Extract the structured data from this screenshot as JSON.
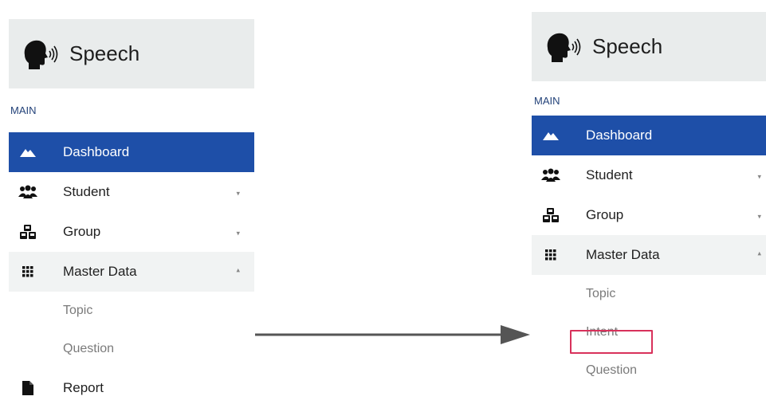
{
  "left_panel": {
    "brand": "Speech",
    "section": "MAIN",
    "items": [
      {
        "label": "Dashboard",
        "icon": "mountain-icon"
      },
      {
        "label": "Student",
        "icon": "users-icon"
      },
      {
        "label": "Group",
        "icon": "cubes-icon"
      },
      {
        "label": "Master Data",
        "icon": "grid-icon"
      }
    ],
    "subitems": [
      "Topic",
      "Question"
    ],
    "after": {
      "label": "Report",
      "icon": "file-icon"
    }
  },
  "right_panel": {
    "brand": "Speech",
    "section": "MAIN",
    "items": [
      {
        "label": "Dashboard",
        "icon": "mountain-icon"
      },
      {
        "label": "Student",
        "icon": "users-icon"
      },
      {
        "label": "Group",
        "icon": "cubes-icon"
      },
      {
        "label": "Master Data",
        "icon": "grid-icon"
      }
    ],
    "subitems": [
      "Topic",
      "Intent",
      "Question"
    ]
  },
  "colors": {
    "active_bg": "#1e4fa8",
    "header_bg": "#e9ecec",
    "highlight_border": "#d8315b",
    "arrow": "#555555"
  }
}
